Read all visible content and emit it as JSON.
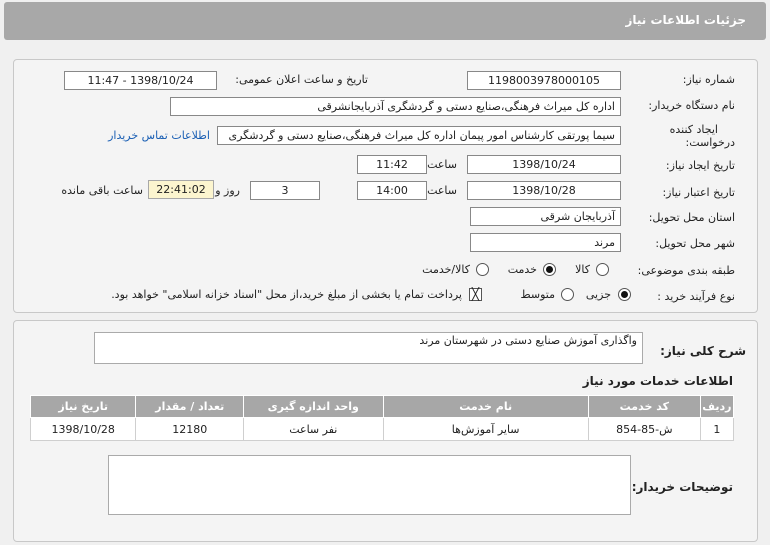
{
  "header": {
    "title": "جزئیات اطلاعات نیاز"
  },
  "form": {
    "need_number": {
      "label": "شماره نیاز:",
      "value": "1198003978000105"
    },
    "announce_datetime": {
      "label": "تاریخ و ساعت اعلان عمومی:",
      "value": "1398/10/24 - 11:47"
    },
    "buyer_org": {
      "label": "نام دستگاه خریدار:",
      "value": "اداره کل میراث فرهنگی،صنایع دستی و گردشگری آذربایجانشرقی"
    },
    "requester": {
      "label_line1": "ایجاد کننده",
      "label_line2": "درخواست:",
      "value": "سیما پورتقی کارشناس امور پیمان اداره کل میراث فرهنگی،صنایع دستی و گردشگری",
      "contact_link": "اطلاعات تماس خریدار"
    },
    "created": {
      "label": "تاریخ ایجاد نیاز:",
      "date": "1398/10/24",
      "time_label": "ساعت",
      "time": "11:42"
    },
    "validity": {
      "label": "تاریخ اعتبار نیاز:",
      "date": "1398/10/28",
      "time_label": "ساعت",
      "time": "14:00",
      "days": "3",
      "days_label": "روز و",
      "remaining": "22:41:02",
      "remaining_label": "ساعت باقی مانده"
    },
    "province": {
      "label": "استان محل تحویل:",
      "value": "آذربایجان شرقی"
    },
    "city": {
      "label": "شهر محل تحویل:",
      "value": "مرند"
    },
    "category": {
      "label": "طبقه بندی موضوعی:",
      "options": [
        "کالا",
        "خدمت",
        "کالا/خدمت"
      ],
      "selected": "خدمت"
    },
    "purchase_process": {
      "label": "نوع فرآیند خرید :",
      "options": [
        "جزیی",
        "متوسط"
      ],
      "selected": "جزیی",
      "payment_note": "پرداخت تمام یا بخشی از مبلغ خرید،از محل \"اسناد خزانه اسلامی\" خواهد بود."
    }
  },
  "summary": {
    "label": "شرح کلی نیاز:",
    "value": "واگذاری آموزش صنایع دستی در شهرستان مرند"
  },
  "services": {
    "heading": "اطلاعات خدمات مورد نیاز",
    "columns": [
      "ردیف",
      "کد خدمت",
      "نام خدمت",
      "واحد اندازه گیری",
      "تعداد / مقدار",
      "تاریخ نیاز"
    ],
    "rows": [
      {
        "row": "1",
        "code": "ش-85-854",
        "name": "سایر آموزش‌ها",
        "unit": "نفر ساعت",
        "qty": "12180",
        "date": "1398/10/28"
      }
    ]
  },
  "buyer_notes": {
    "label": "توضیحات خریدار:",
    "value": ""
  }
}
